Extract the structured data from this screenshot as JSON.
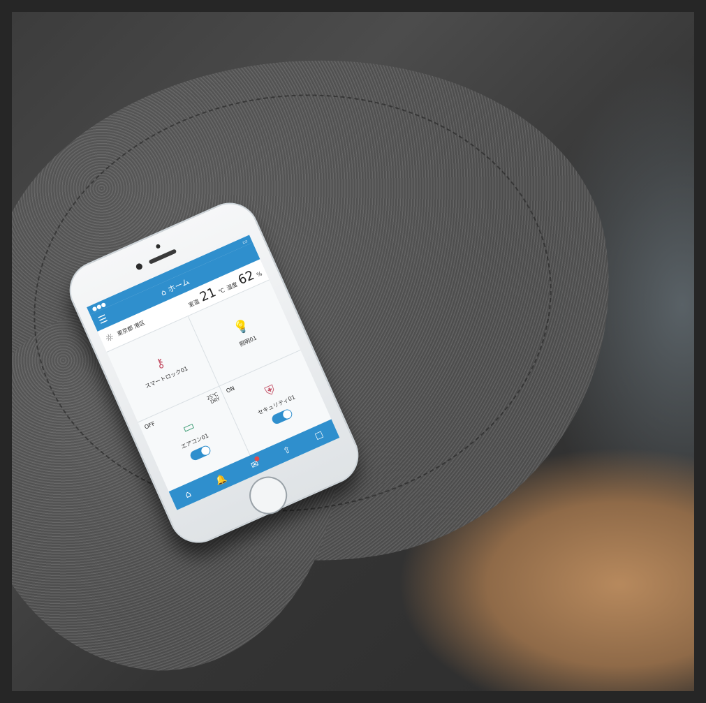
{
  "app": {
    "nav_title": "ホーム",
    "weather": {
      "place": "東京都 港区",
      "temperature_label": "室温",
      "temperature_value": "21",
      "temperature_unit": "℃",
      "humidity_label": "湿度",
      "humidity_value": "62",
      "humidity_unit": "%"
    },
    "tiles": [
      {
        "name": "スマートロック01",
        "icon": "key-icon"
      },
      {
        "name": "照明01",
        "icon": "bulb-icon"
      },
      {
        "name": "エアコン01",
        "state": "OFF",
        "temperature": "25℃",
        "mode": "DRY",
        "toggle": true,
        "icon": "aircon-icon"
      },
      {
        "name": "セキュリティ01",
        "state": "ON",
        "toggle": true,
        "icon": "shield-icon"
      }
    ],
    "tabbar": [
      "home-icon",
      "bell-icon",
      "message-icon",
      "upload-icon",
      "bookmark-icon"
    ]
  },
  "colors": {
    "accent": "#2f8fcd",
    "badge": "#e24b4b"
  }
}
